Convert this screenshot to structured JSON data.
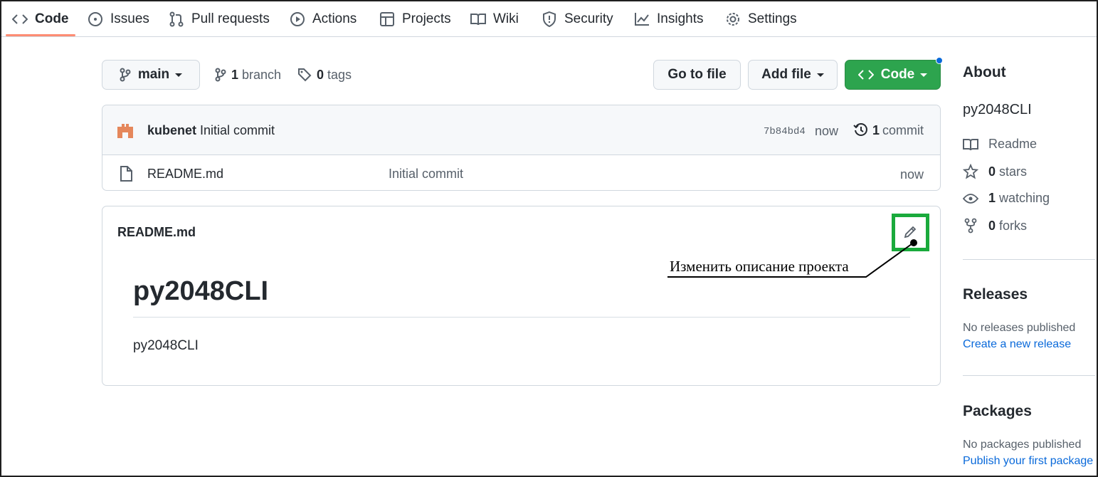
{
  "nav": {
    "tabs": [
      {
        "label": "Code",
        "icon": "code-icon"
      },
      {
        "label": "Issues",
        "icon": "issue-icon"
      },
      {
        "label": "Pull requests",
        "icon": "pull-request-icon"
      },
      {
        "label": "Actions",
        "icon": "play-icon"
      },
      {
        "label": "Projects",
        "icon": "table-icon"
      },
      {
        "label": "Wiki",
        "icon": "book-icon"
      },
      {
        "label": "Security",
        "icon": "shield-icon"
      },
      {
        "label": "Insights",
        "icon": "graph-icon"
      },
      {
        "label": "Settings",
        "icon": "gear-icon"
      }
    ]
  },
  "branch": {
    "current": "main",
    "branches_count": "1",
    "branches_label": "branch",
    "tags_count": "0",
    "tags_label": "tags"
  },
  "toolbar": {
    "go_to_file": "Go to file",
    "add_file": "Add file",
    "code": "Code"
  },
  "commit": {
    "author": "kubenet",
    "message": "Initial commit",
    "hash": "7b84bd4",
    "time": "now",
    "count": "1",
    "count_label": "commit"
  },
  "files": [
    {
      "name": "README.md",
      "message": "Initial commit",
      "time": "now"
    }
  ],
  "readme": {
    "filename": "README.md",
    "heading": "py2048CLI",
    "body": "py2048CLI"
  },
  "annotation": {
    "text": "Изменить описание проекта",
    "color": "#1aaa3c"
  },
  "about": {
    "title": "About",
    "description": "py2048CLI",
    "readme": "Readme",
    "stars_count": "0",
    "stars_label": "stars",
    "watching_count": "1",
    "watching_label": "watching",
    "forks_count": "0",
    "forks_label": "forks"
  },
  "releases": {
    "title": "Releases",
    "empty": "No releases published",
    "link": "Create a new release"
  },
  "packages": {
    "title": "Packages",
    "empty": "No packages published",
    "link": "Publish your first package"
  }
}
